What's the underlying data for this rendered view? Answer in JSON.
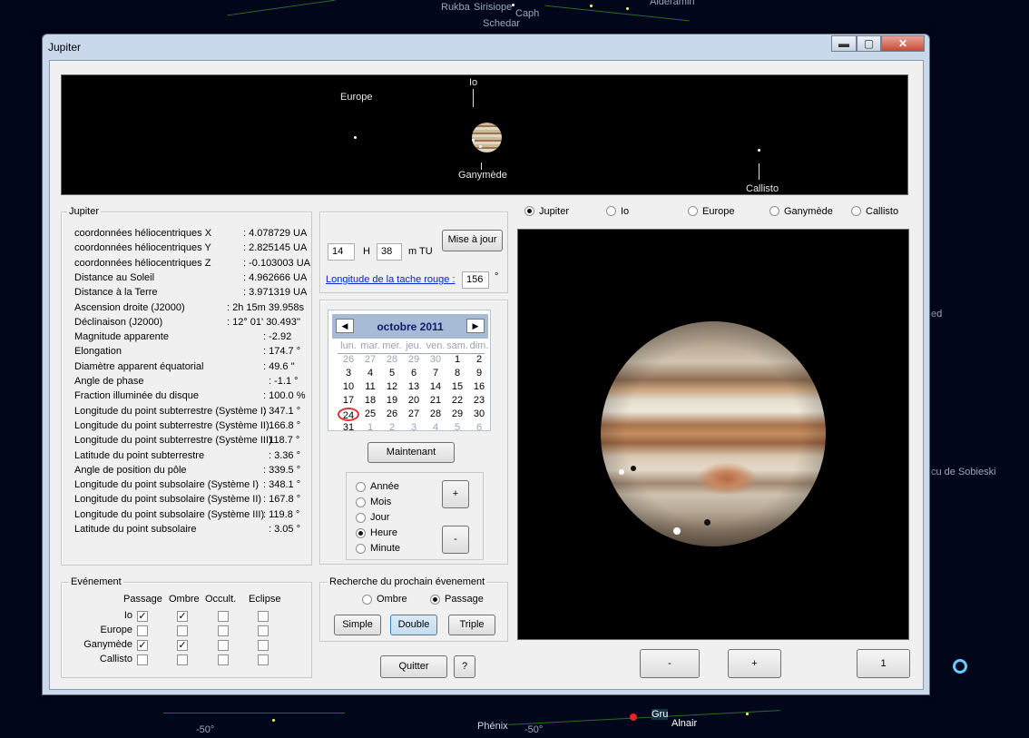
{
  "background": {
    "labels": [
      "Rukba",
      "Sirisiope",
      "Caph",
      "Schedar",
      "Alderamin",
      "cu de Sobieski",
      "Phénix",
      "Gru",
      "Alnair",
      "-50°",
      "-50°",
      "-50°",
      "ed",
      "Alnair"
    ]
  },
  "window": {
    "title": "Jupiter",
    "controls": {
      "minimize": "▬",
      "maximize": "▢",
      "close": "✕"
    }
  },
  "top_view": {
    "moons": {
      "europe": "Europe",
      "io": "Io",
      "ganymede": "Ganymède",
      "callisto": "Callisto"
    }
  },
  "info": {
    "group_title": "Jupiter",
    "rows": [
      {
        "label": "coordonnées héliocentriques X",
        "value": ": 4.078729 UA"
      },
      {
        "label": "coordonnées héliocentriques Y",
        "value": ": 2.825145 UA"
      },
      {
        "label": "coordonnées héliocentriques Z",
        "value": ": -0.103003 UA"
      },
      {
        "label": "Distance au Soleil",
        "value": ": 4.962666 UA"
      },
      {
        "label": "Distance à la Terre",
        "value": ": 3.971319 UA"
      },
      {
        "label": "Ascension droite (J2000)",
        "value": ":    2h 15m 39.958s"
      },
      {
        "label": "Déclinaison (J2000)",
        "value": ":    12° 01' 30.493''"
      },
      {
        "label": "Magnitude apparente",
        "value": ": -2.92"
      },
      {
        "label": "Elongation",
        "value": ": 174.7 °"
      },
      {
        "label": "Diamètre apparent équatorial",
        "value": ": 49.6 ''"
      },
      {
        "label": "Angle de phase",
        "value": ":  -1.1 °"
      },
      {
        "label": "Fraction illuminée du disque",
        "value": ": 100.0 %"
      },
      {
        "label": "Longitude du point subterrestre (Système I)",
        "value": ": 347.1 °"
      },
      {
        "label": "Longitude du point subterrestre (Système II)",
        "value": ": 166.8 °"
      },
      {
        "label": "Longitude du point subterrestre (Système III)",
        "value": ": 118.7 °"
      },
      {
        "label": "Latitude du point subterrestre",
        "value": ":  3.36 °"
      },
      {
        "label": "Angle de position du pôle",
        "value": ": 339.5 °"
      },
      {
        "label": "Longitude du point subsolaire (Système I)",
        "value": ": 348.1 °"
      },
      {
        "label": "Longitude du point subsolaire (Système II)",
        "value": ": 167.8 °"
      },
      {
        "label": "Longitude du point subsolaire (Système III)",
        "value": ": 119.8 °"
      },
      {
        "label": "Latitude du point subsolaire",
        "value": ":  3.05 °"
      }
    ]
  },
  "events": {
    "group_title": "Evénement",
    "columns": [
      "Passage",
      "Ombre",
      "Occult.",
      "Eclipse"
    ],
    "rows": [
      {
        "label": "Io",
        "checks": [
          "✓",
          "✓",
          "",
          ""
        ]
      },
      {
        "label": "Europe",
        "checks": [
          "",
          "",
          "",
          ""
        ]
      },
      {
        "label": "Ganymède",
        "checks": [
          "✓",
          "✓",
          "",
          ""
        ]
      },
      {
        "label": "Callisto",
        "checks": [
          "",
          "",
          "",
          ""
        ]
      }
    ]
  },
  "time": {
    "hours": "14",
    "h_label": "H",
    "minutes": "38",
    "m_label": "m TU",
    "update_button": "Mise à jour",
    "red_spot_link": "Longitude de la tache rouge :",
    "red_spot_value": "156",
    "degree": "°"
  },
  "calendar": {
    "month_title": "octobre 2011",
    "prev": "◀",
    "next": "▶",
    "weekdays": [
      "lun.",
      "mar.",
      "mer.",
      "jeu.",
      "ven.",
      "sam.",
      "dim."
    ],
    "weeks": [
      [
        "26",
        "27",
        "28",
        "29",
        "30",
        "1",
        "2"
      ],
      [
        "3",
        "4",
        "5",
        "6",
        "7",
        "8",
        "9"
      ],
      [
        "10",
        "11",
        "12",
        "13",
        "14",
        "15",
        "16"
      ],
      [
        "17",
        "18",
        "19",
        "20",
        "21",
        "22",
        "23"
      ],
      [
        "24",
        "25",
        "26",
        "27",
        "28",
        "29",
        "30"
      ],
      [
        "31",
        "1",
        "2",
        "3",
        "4",
        "5",
        "6"
      ]
    ],
    "today_button": "Maintenant"
  },
  "step": {
    "options": [
      "Année",
      "Mois",
      "Jour",
      "Heure",
      "Minute"
    ],
    "selected": "Heure",
    "plus": "+",
    "minus": "-"
  },
  "search": {
    "group_title": "Recherche du prochain évenement",
    "options": [
      "Ombre",
      "Passage"
    ],
    "selected": "Passage",
    "buttons": [
      "Simple",
      "Double",
      "Triple"
    ]
  },
  "bottom": {
    "quit": "Quitter",
    "help": "?"
  },
  "view_select": {
    "options": [
      "Jupiter",
      "Io",
      "Europe",
      "Ganymède",
      "Callisto"
    ],
    "selected": "Jupiter"
  },
  "zoom": {
    "minus": "-",
    "plus": "+",
    "value": "1"
  },
  "colors": {
    "window_frame": "#c9d8ea",
    "client": "#f0f0f0",
    "calendar_header": "#a6bcd6",
    "link": "#0026c8"
  }
}
